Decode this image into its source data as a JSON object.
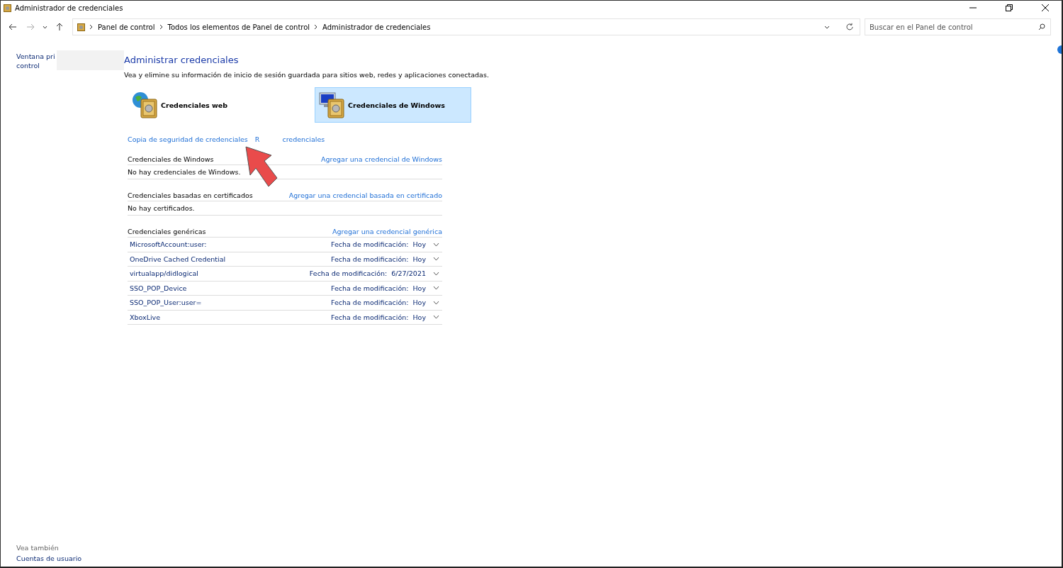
{
  "window": {
    "title": "Administrador de credenciales"
  },
  "address_bar": {
    "breadcrumbs": [
      "Panel de control",
      "Todos los elementos de Panel de control",
      "Administrador de credenciales"
    ]
  },
  "search": {
    "placeholder": "Buscar en el Panel de control"
  },
  "sidebar": {
    "top_link_lines": [
      "Ventana pri",
      "control"
    ],
    "see_also": "Vea también",
    "links": [
      "Cuentas de usuario"
    ]
  },
  "heading": "Administrar credenciales",
  "description": "Vea y elimine su información de inicio de sesión guardada para sitios web, redes y aplicaciones conectadas.",
  "cards": [
    {
      "label": "Credenciales web",
      "kind": "web",
      "selected": false
    },
    {
      "label": "Credenciales de Windows",
      "kind": "windows",
      "selected": true
    }
  ],
  "actions": {
    "backup": "Copia de seguridad de credenciales",
    "restore_parts": [
      "R",
      "credenciales"
    ]
  },
  "sections": [
    {
      "title": "Credenciales de Windows",
      "add_link": "Agregar una credencial de Windows",
      "empty": "No hay credenciales de Windows."
    },
    {
      "title": "Credenciales basadas en certificados",
      "add_link": "Agregar una credencial basada en certificado",
      "empty": "No hay certificados."
    },
    {
      "title": "Credenciales genéricas",
      "add_link": "Agregar una credencial genérica",
      "items": [
        {
          "name": "MicrosoftAccount:user:",
          "date_label": "Fecha de modificación:",
          "date": "Hoy",
          "expanded": false
        },
        {
          "name": "OneDrive Cached Credential",
          "date_label": "Fecha de modificación:",
          "date": "Hoy",
          "expanded": false
        },
        {
          "name": "virtualapp/didlogical",
          "date_label": "Fecha de modificación:",
          "date": "6/27/2021",
          "expanded": false
        },
        {
          "name": "SSO_POP_Device",
          "date_label": "Fecha de modificación:",
          "date": "Hoy",
          "expanded": false
        },
        {
          "name": "SSO_POP_User:user=",
          "date_label": "Fecha de modificación:",
          "date": "Hoy",
          "expanded": false
        },
        {
          "name": "XboxLive",
          "date_label": "Fecha de modificación:",
          "date": "Hoy",
          "expanded": false
        }
      ]
    }
  ]
}
